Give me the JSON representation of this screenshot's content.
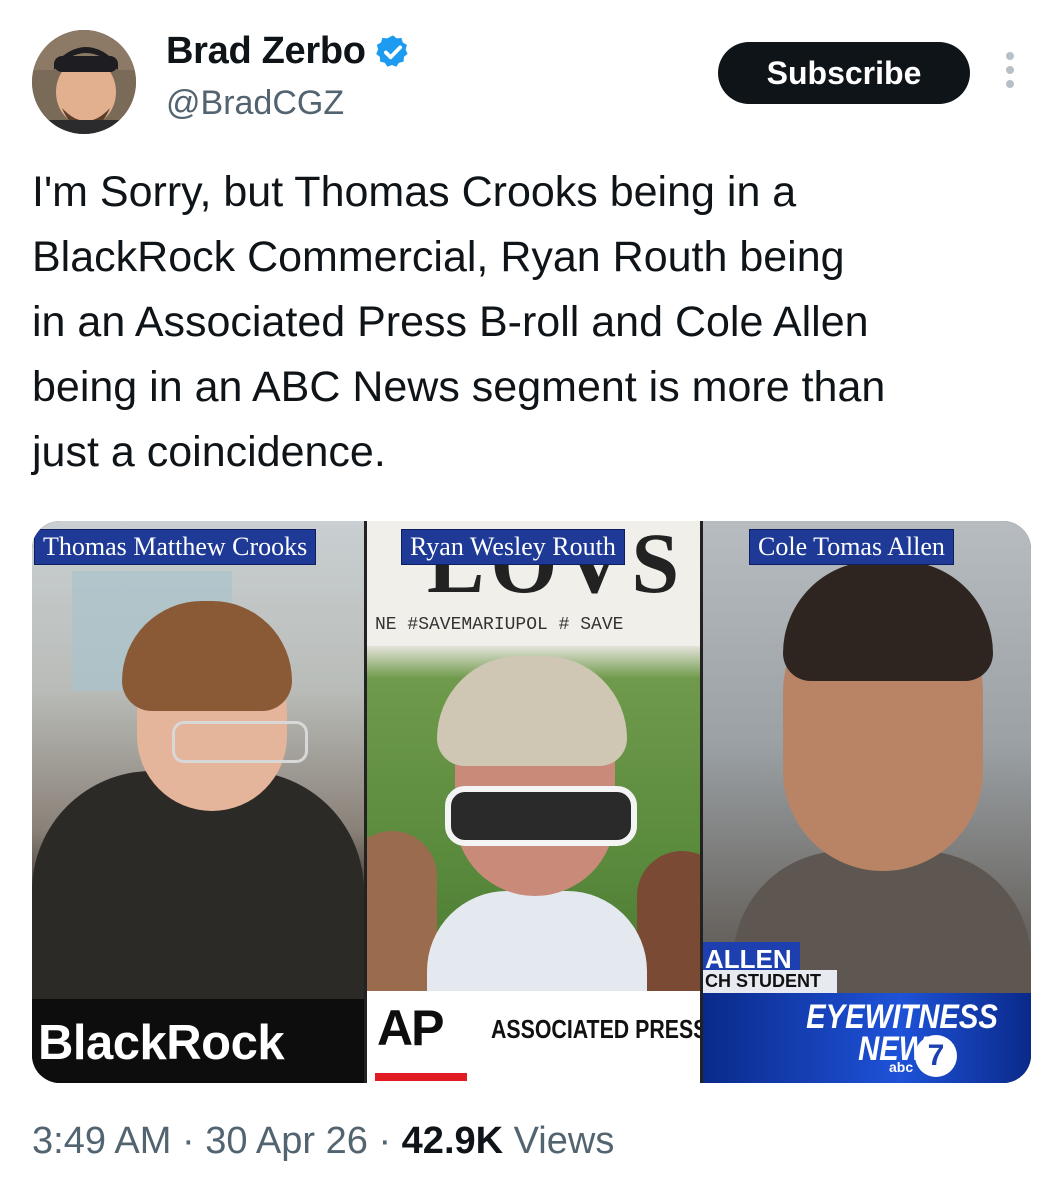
{
  "author": {
    "name": "Brad Zerbo",
    "handle": "@BradCGZ",
    "verified": true,
    "verified_icon": "verified-badge-icon",
    "verified_color": "#1d9bf0"
  },
  "actions": {
    "subscribe_label": "Subscribe",
    "more_icon": "more-options-icon"
  },
  "tweet": {
    "text": "I'm Sorry, but Thomas Crooks being in a\nBlackRock Commercial, Ryan Routh being\nin an Associated Press B-roll and Cole Allen\nbeing in an ABC News segment is more than\njust a coincidence."
  },
  "media": {
    "panels": [
      {
        "caption": "Thomas Matthew Crooks",
        "logo_text": "BlackRock"
      },
      {
        "caption": "Ryan Wesley Routh",
        "sign_text": "LOVS",
        "sign_tags": "NE  #SAVEMARIUPOL  # SAVE",
        "logo_mark": "AP",
        "logo_text": "ASSOCIATED PRESS"
      },
      {
        "caption": "Cole Tomas Allen",
        "lower_third_name": "ALLEN",
        "lower_third_sub": "CH STUDENT",
        "logo_text": "EYEWITNESS NEWS",
        "network_text": "abc",
        "channel": "7"
      }
    ]
  },
  "meta": {
    "time": "3:49 AM",
    "separator": "·",
    "date": "30 Apr 26",
    "views_count": "42.9K",
    "views_label": "Views"
  },
  "colors": {
    "text": "#0f1419",
    "secondary": "#536471",
    "caption_bg": "#1e3a96",
    "ap_red": "#e11b22"
  }
}
